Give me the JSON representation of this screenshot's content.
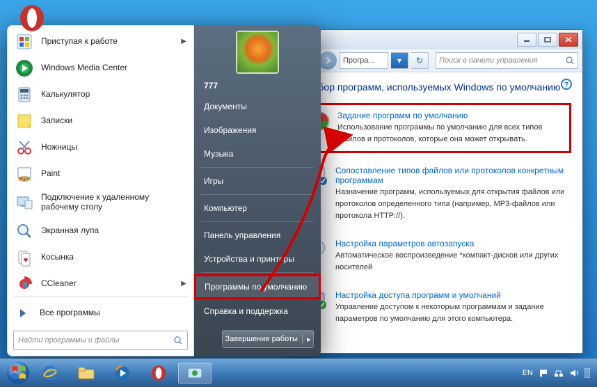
{
  "control_panel": {
    "breadcrumb": "Програ...",
    "search_placeholder": "Поиск в панели управления",
    "heading": "Выбор программ, используемых Windows по умолчанию",
    "options": [
      {
        "link": "Задание программ по умолчанию",
        "desc": "Использование программы по умолчанию для всех типов файлов и протоколов, которые она может открывать."
      },
      {
        "link": "Сопоставление типов файлов или протоколов конкретным программам",
        "desc": "Назначение программ, используемых для открытия файлов или протоколов определенного типа (например, MP3-файлов  или протокола HTTP://)."
      },
      {
        "link": "Настройка параметров автозапуска",
        "desc": "Автоматическое воспроизведение *компакт-дисков или других носителей"
      },
      {
        "link": "Настройка доступа программ и умолчаний",
        "desc": "Управление доступом к некоторым программам и задание параметров по умолчанию для этого компьютера."
      }
    ]
  },
  "start_menu": {
    "left_items": [
      {
        "label": "Приступая к работе",
        "has_arrow": true,
        "icon": "getstarted"
      },
      {
        "label": "Windows Media Center",
        "icon": "wmc"
      },
      {
        "label": "Калькулятор",
        "icon": "calc"
      },
      {
        "label": "Записки",
        "icon": "sticky"
      },
      {
        "label": "Ножницы",
        "icon": "snip"
      },
      {
        "label": "Paint",
        "icon": "paint"
      },
      {
        "label": "Подключение к удаленному рабочему столу",
        "icon": "rdp",
        "multi": true
      },
      {
        "label": "Экранная лупа",
        "icon": "magnify"
      },
      {
        "label": "Косынка",
        "icon": "solitaire"
      },
      {
        "label": "CCleaner",
        "has_arrow": true,
        "icon": "ccleaner"
      }
    ],
    "all_programs": "Все программы",
    "search_placeholder": "Найти программы и файлы",
    "user": "777",
    "right_items": [
      "Документы",
      "Изображения",
      "Музыка",
      "Игры",
      "Компьютер",
      "Панель управления",
      "Устройства и принтеры",
      "Программы по умолчанию",
      "Справка и поддержка"
    ],
    "shutdown": "Завершение работы"
  },
  "taskbar": {
    "lang": "EN"
  }
}
